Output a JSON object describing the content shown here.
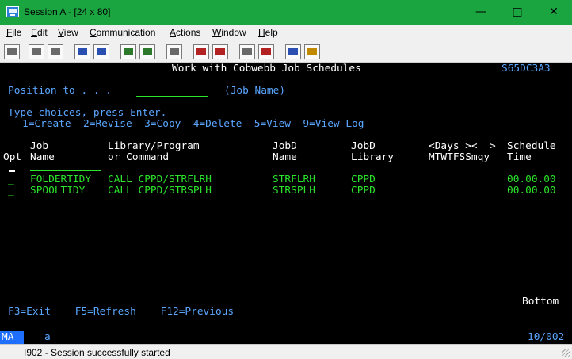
{
  "window": {
    "title": "Session A - [24 x 80]",
    "controls": {
      "minimize": "—",
      "maximize": "□",
      "close": "✕"
    }
  },
  "menu": {
    "items": [
      {
        "label": "File",
        "access": "F"
      },
      {
        "label": "Edit",
        "access": "E"
      },
      {
        "label": "View",
        "access": "V"
      },
      {
        "label": "Communication",
        "access": "C"
      },
      {
        "label": "Actions",
        "access": "A"
      },
      {
        "label": "Window",
        "access": "W"
      },
      {
        "label": "Help",
        "access": "H"
      }
    ]
  },
  "toolbar": {
    "icons": [
      "print-screen-icon",
      "copy-icon",
      "paste-icon",
      "send-icon",
      "receive-icon",
      "display-keypad-icon",
      "map-icon",
      "record-macro-icon",
      "stop-macro-icon",
      "play-macro-icon",
      "send-file-icon",
      "receive-file-icon",
      "globe-icon",
      "support-icon"
    ]
  },
  "screen": {
    "title": "Work with Cobwebb Job Schedules",
    "system_name": "S65DC3A3",
    "position_to_label": "Position to . . .",
    "position_to_hint": "(Job Name)",
    "instructions": "Type choices, press Enter.",
    "options": "1=Create  2=Revise  3=Copy  4=Delete  5=View  9=View Log",
    "headers": {
      "opt": "Opt",
      "job_1": "Job",
      "job_2": "Name",
      "libprog_1": "Library/Program",
      "libprog_2": "or Command",
      "jobd_1": "JobD",
      "jobd_2": "Name",
      "jobdlib_1": "JobD",
      "jobdlib_2": "Library",
      "days_1": "<Days ><  >",
      "days_2": "MTWTFSSmqy",
      "sched_1": "Schedule",
      "sched_2": "Time"
    },
    "rows": [
      {
        "opt": "_",
        "job": "FOLDERTIDY",
        "command": "CALL CPPD/STRFLRH",
        "jobd_name": "STRFLRH",
        "jobd_lib": "CPPD",
        "time": "00.00.00"
      },
      {
        "opt": "_",
        "job": "SPOOLTIDY",
        "command": "CALL CPPD/STRSPLH",
        "jobd_name": "STRSPLH",
        "jobd_lib": "CPPD",
        "time": "00.00.00"
      }
    ],
    "more": "Bottom",
    "function_keys": "F3=Exit    F5=Refresh    F12=Previous"
  },
  "oia": {
    "mode": "MA",
    "indicator": "a",
    "cursor_position": "10/002"
  },
  "status": {
    "message": "I902 - Session successfully started"
  }
}
